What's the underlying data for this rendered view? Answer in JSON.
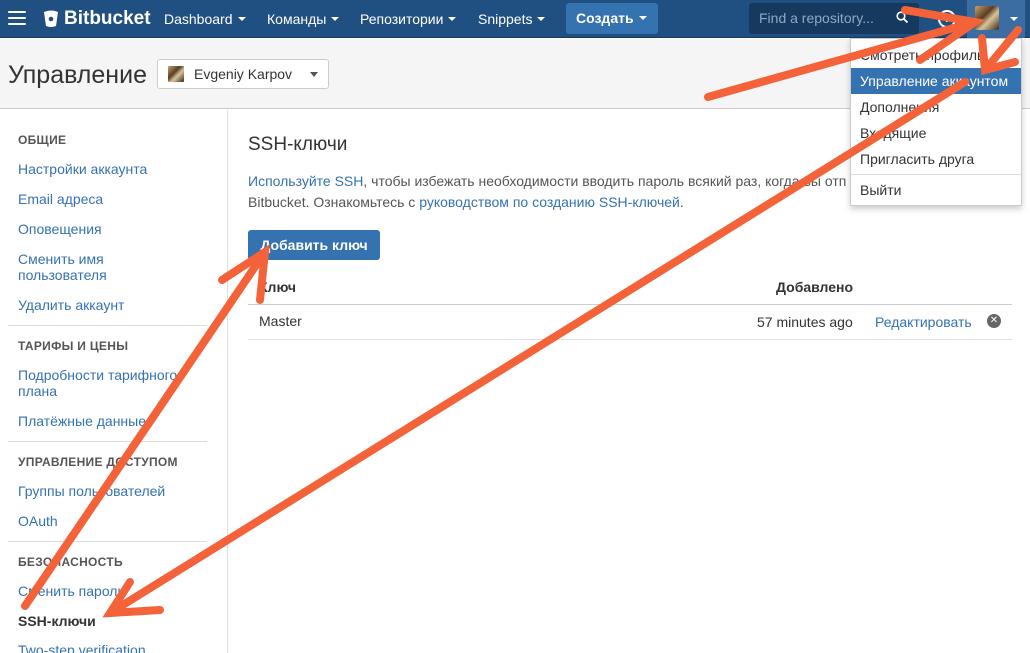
{
  "topbar": {
    "logo_text": "Bitbucket",
    "nav": [
      "Dashboard",
      "Команды",
      "Репозитории",
      "Snippets"
    ],
    "create_label": "Создать",
    "search_placeholder": "Find a repository...",
    "help_label": "?"
  },
  "header": {
    "title": "Управление",
    "user_name": "Evgeniy Karpov"
  },
  "sidebar": {
    "sections": [
      {
        "heading": "ОБЩИЕ",
        "items": [
          "Настройки аккаунта",
          "Email адреса",
          "Оповещения",
          "Сменить имя пользователя",
          "Удалить аккаунт"
        ]
      },
      {
        "heading": "ТАРИФЫ И ЦЕНЫ",
        "items": [
          "Подробности тарифного плана",
          "Платёжные данные"
        ]
      },
      {
        "heading": "УПРАВЛЕНИЕ ДОСТУПОМ",
        "items": [
          "Группы пользователей",
          "OAuth"
        ]
      },
      {
        "heading": "БЕЗОПАСНОСТЬ",
        "items": [
          "Сменить пароль",
          "SSH-ключи",
          "Two-step verification"
        ]
      }
    ],
    "labels": {
      "s0_heading": "ОБЩИЕ",
      "s0_i0": "Настройки аккаунта",
      "s0_i1": "Email адреса",
      "s0_i2": "Оповещения",
      "s0_i3a": "Сменить имя",
      "s0_i3b": "пользователя",
      "s0_i4": "Удалить аккаунт",
      "s1_heading": "ТАРИФЫ И ЦЕНЫ",
      "s1_i0a": "Подробности тарифного",
      "s1_i0b": "плана",
      "s1_i1": "Платёжные данные",
      "s2_heading": "УПРАВЛЕНИЕ ДОСТУПОМ",
      "s2_i0": "Группы пользователей",
      "s2_i1": "OAuth",
      "s3_heading": "БЕЗОПАСНОСТЬ",
      "s3_i0": "Сменить пароль",
      "s3_i1": "SSH-ключи",
      "s3_i2": "Two-step verification"
    }
  },
  "main": {
    "title": "SSH-ключи",
    "desc_link1": "Используйте SSH",
    "desc_text1": ", чтобы избежать необходимости вводить пароль всякий раз, когда вы отп",
    "desc_text2": "Bitbucket. Ознакомьтесь с ",
    "desc_link2": "руководством по созданию SSH-ключей",
    "desc_text3": ".",
    "add_button": "Добавить ключ",
    "table": {
      "columns": [
        "Ключ",
        "Добавлено"
      ],
      "rows": [
        {
          "key": "Master",
          "added": "57 minutes ago",
          "edit": "Редактировать"
        }
      ]
    }
  },
  "dropdown": {
    "items": [
      "Смотреть профиль",
      "Управление аккаунтом",
      "Дополнения",
      "Входящие",
      "Пригласить друга",
      "Выйти"
    ],
    "active_index": 1
  },
  "colors": {
    "topbar": "#205081",
    "accent": "#3572b0",
    "annotation_arrow": "#f4623a"
  }
}
